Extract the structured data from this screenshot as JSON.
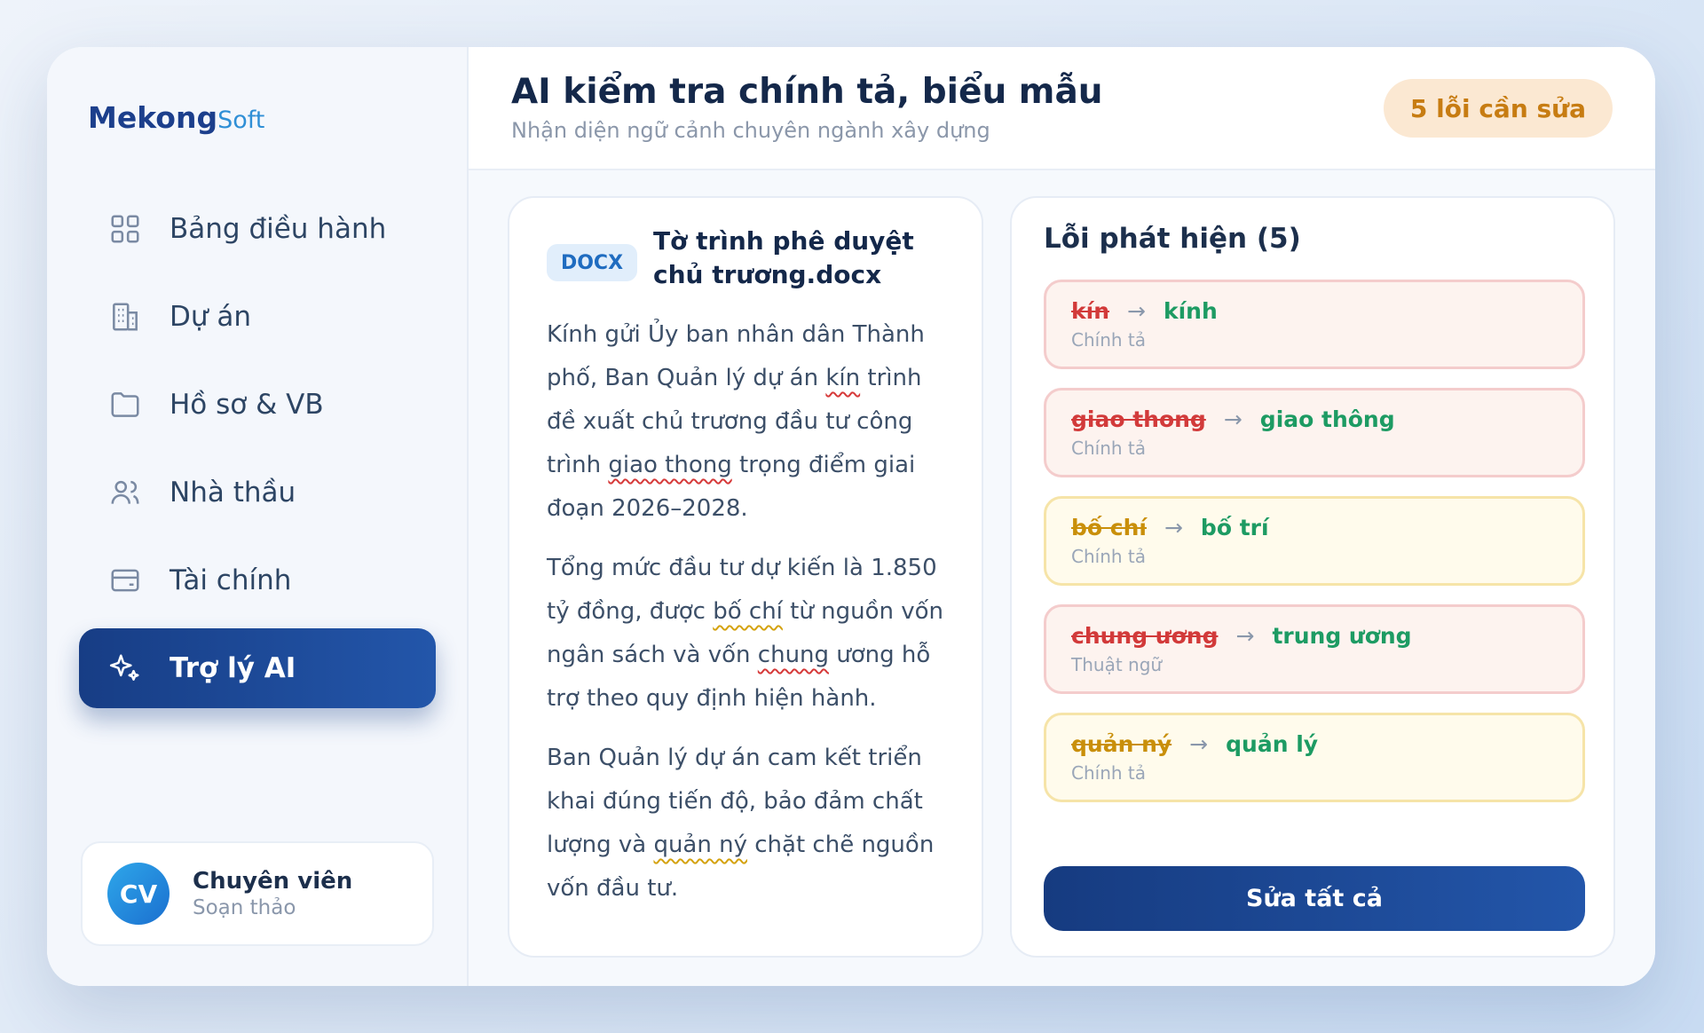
{
  "brand": {
    "main": "Mekong",
    "suffix": "Soft"
  },
  "sidebar": {
    "items": [
      {
        "label": "Bảng điều hành",
        "icon": "grid-icon"
      },
      {
        "label": "Dự án",
        "icon": "building-icon"
      },
      {
        "label": "Hồ sơ & VB",
        "icon": "folder-icon"
      },
      {
        "label": "Nhà thầu",
        "icon": "users-icon"
      },
      {
        "label": "Tài chính",
        "icon": "wallet-icon"
      },
      {
        "label": "Trợ lý AI",
        "icon": "sparkles-icon",
        "active": true
      }
    ]
  },
  "user": {
    "initials": "CV",
    "name": "Chuyên viên",
    "role": "Soạn thảo"
  },
  "header": {
    "title": "AI kiểm tra chính tả, biểu mẫu",
    "subtitle": "Nhận diện ngữ cảnh chuyên ngành xây dựng",
    "badge": "5 lỗi cần sửa"
  },
  "document": {
    "tag": "DOCX",
    "title": "Tờ trình phê duyệt chủ trương.docx",
    "p1": {
      "a": "Kính gửi Ủy ban nhân dân Thành phố, Ban Quản lý dự án ",
      "e1": "kín",
      "b": " trình đề xuất chủ trương đầu tư công trình ",
      "e2": "giao thong",
      "c": " trọng điểm giai đoạn 2026–2028."
    },
    "p2": {
      "a": "Tổng mức đầu tư dự kiến là 1.850 tỷ đồng, được ",
      "e1": "bố chí",
      "b": " từ nguồn vốn ngân sách và vốn ",
      "e2": "chung",
      "c": " ương hỗ trợ theo quy định hiện hành."
    },
    "p3": {
      "a": "Ban Quản lý dự án cam kết triển khai đúng tiến độ, bảo đảm chất lượng và ",
      "e1": "quản ný",
      "b": " chặt chẽ nguồn vốn đầu tư."
    }
  },
  "errors": {
    "title": "Lỗi phát hiện (5)",
    "items": [
      {
        "wrong": "kín",
        "right": "kính",
        "type": "Chính tả",
        "severity": "red"
      },
      {
        "wrong": "giao thong",
        "right": "giao thông",
        "type": "Chính tả",
        "severity": "red"
      },
      {
        "wrong": "bố chí",
        "right": "bố trí",
        "type": "Chính tả",
        "severity": "yellow"
      },
      {
        "wrong": "chung ương",
        "right": "trung ương",
        "type": "Thuật ngữ",
        "severity": "red"
      },
      {
        "wrong": "quản ný",
        "right": "quản lý",
        "type": "Chính tả",
        "severity": "yellow"
      }
    ],
    "fix_all": "Sửa tất cả"
  },
  "colors": {
    "primary": "#1c4a9a",
    "badge_bg": "#fbe8d2",
    "badge_text": "#c77c12",
    "error_red": "#d23a3a",
    "error_yellow": "#c98f0a",
    "correct_green": "#1d9b63"
  }
}
